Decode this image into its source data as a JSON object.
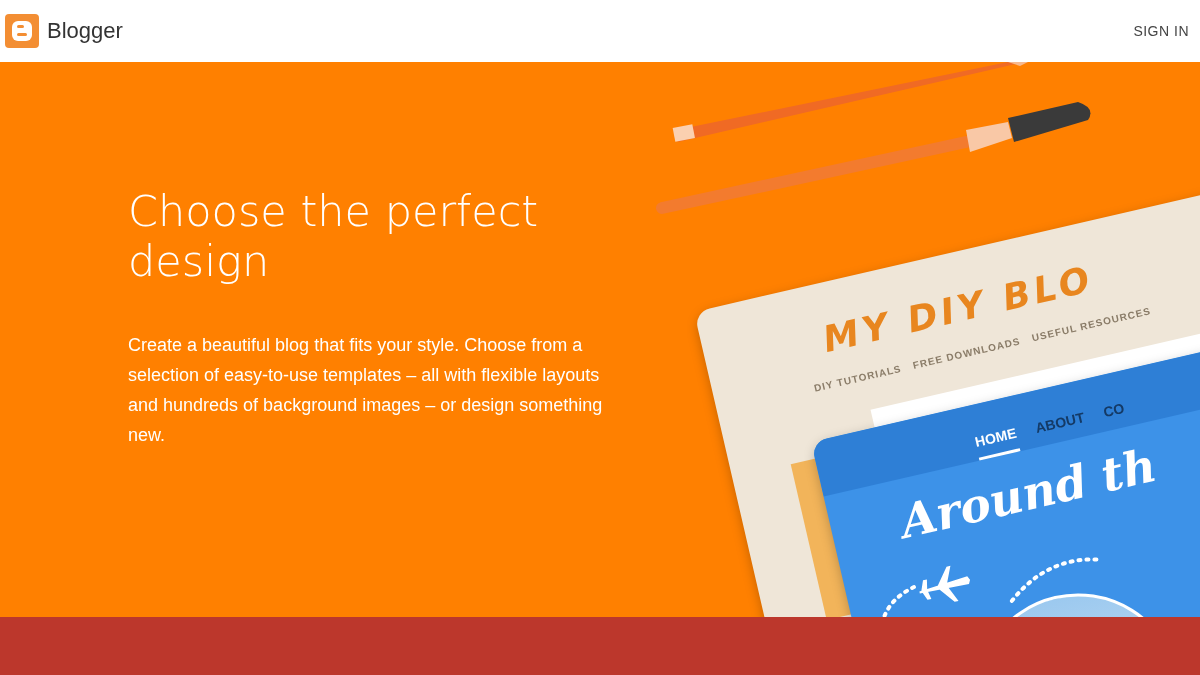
{
  "header": {
    "brand": "Blogger",
    "sign_in": "SIGN IN"
  },
  "hero": {
    "heading": "Choose the perfect design",
    "body": "Create a beautiful blog that fits your style. Choose from a selection of easy-to-use templates – all with flexible layouts and hundreds of background images – or design something new."
  },
  "illustration": {
    "template_1": {
      "title": "MY DIY BLO",
      "nav": [
        "DIY TUTORIALS",
        "FREE DOWNLOADS",
        "USEFUL RESOURCES"
      ]
    },
    "template_2": {
      "nav": [
        {
          "label": "HOME",
          "selected": true
        },
        {
          "label": "ABOUT",
          "selected": false
        },
        {
          "label": "CO",
          "selected": false
        }
      ],
      "title": "Around th"
    }
  }
}
